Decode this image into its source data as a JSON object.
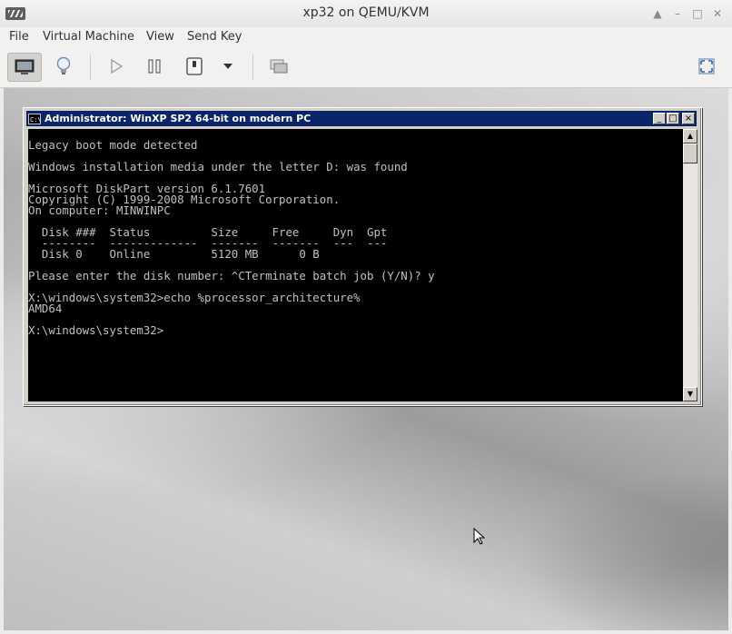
{
  "window": {
    "title": "xp32 on QEMU/KVM"
  },
  "menubar": {
    "items": [
      "File",
      "Virtual Machine",
      "View",
      "Send Key"
    ]
  },
  "toolbar": {
    "buttons": [
      "console-view",
      "details-view",
      "run",
      "pause",
      "shutdown",
      "shutdown-menu",
      "snapshots",
      "fullscreen"
    ]
  },
  "console": {
    "title": "Administrator:  WinXP SP2 64-bit on modern PC",
    "icon_text": "C:\\",
    "lines": [
      "Legacy boot mode detected",
      "",
      "Windows installation media under the letter D: was found",
      "",
      "Microsoft DiskPart version 6.1.7601",
      "Copyright (C) 1999-2008 Microsoft Corporation.",
      "On computer: MINWINPC",
      "",
      "  Disk ###  Status         Size     Free     Dyn  Gpt",
      "  --------  -------------  -------  -------  ---  ---",
      "  Disk 0    Online         5120 MB      0 B",
      "",
      "Please enter the disk number: ^CTerminate batch job (Y/N)? y",
      "",
      "X:\\windows\\system32>echo %processor_architecture%",
      "AMD64",
      "",
      "X:\\windows\\system32>"
    ]
  },
  "colors": {
    "console_bg": "#000000",
    "console_fg": "#c0c0c0",
    "xp_titlebar": "#0a246a"
  }
}
